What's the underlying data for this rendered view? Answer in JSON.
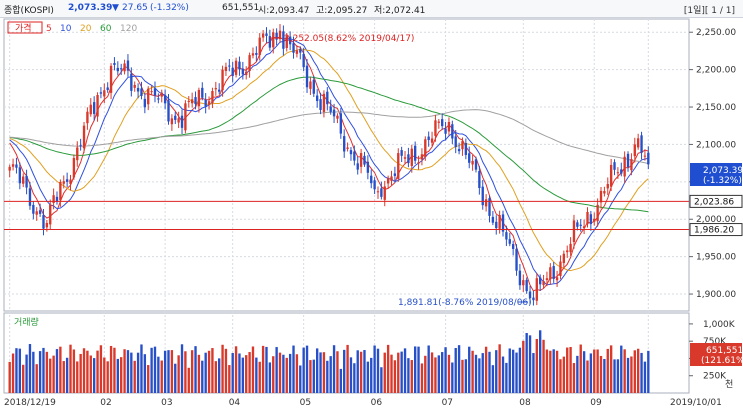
{
  "header": {
    "symbol": "종합(KOSPI)",
    "price": "2,073.39",
    "change_arrow": "▼",
    "change": "27.65",
    "change_pct": "(-1.32%)",
    "volume": "651,551",
    "open": "시:2,093.47",
    "high": "고:2,095.27",
    "low": "저:2,072.41",
    "pager": "[1일][ 1 / 1]"
  },
  "legend": {
    "price_label": "가격",
    "ma": [
      {
        "label": "5",
        "color": "#e03030"
      },
      {
        "label": "10",
        "color": "#3050e0"
      },
      {
        "label": "20",
        "color": "#e0a020"
      },
      {
        "label": "60",
        "color": "#2a9a3a"
      },
      {
        "label": "120",
        "color": "#a0a0a0"
      }
    ],
    "volume_label": "거래량"
  },
  "annotations": {
    "high": "2,252.05(8.62% 2019/04/17)",
    "low": "1,891.81(-8.76% 2019/08/06)"
  },
  "price_axis": {
    "ticks": [
      "2,250.00",
      "2,200.00",
      "2,150.00",
      "2,100.00",
      "2,050.00",
      "2,000.00",
      "1,950.00",
      "1,900.00"
    ],
    "last_box": [
      "2,073.39",
      "(-1.32%)"
    ],
    "hline1": "2,023.86",
    "hline2": "1,986.20"
  },
  "volume_axis": {
    "ticks": [
      "1,000K",
      "750K",
      "500K",
      "250K"
    ],
    "last_box": [
      "651,551",
      "(121.61%)"
    ],
    "unit": "천"
  },
  "x_axis": {
    "labels": [
      "2018/12/19",
      "02",
      "03",
      "04",
      "05",
      "06",
      "07",
      "08",
      "09",
      "2019/10/01"
    ]
  },
  "colors": {
    "up": "#d8392b",
    "down": "#2750c8",
    "hline": "#d22",
    "grid": "#d7dbe2"
  },
  "chart_data": {
    "type": "candlestick",
    "title": "종합(KOSPI)",
    "x_range": [
      "2018/12/19",
      "2019/10/01"
    ],
    "ylim": [
      1880,
      2265
    ],
    "key_points": [
      {
        "x": "2018/12/19",
        "close": 2070
      },
      {
        "x": "2019/01/04",
        "close": 1995
      },
      {
        "x": "2019/02/01",
        "close": 2205
      },
      {
        "x": "2019/03/01",
        "close": 2135
      },
      {
        "x": "2019/04/17",
        "close": 2252.05
      },
      {
        "x": "2019/05/31",
        "close": 2040
      },
      {
        "x": "2019/07/02",
        "close": 2130
      },
      {
        "x": "2019/08/06",
        "close": 1891.81
      },
      {
        "x": "2019/09/20",
        "close": 2100
      },
      {
        "x": "2019/09/27",
        "close": 2073.39
      }
    ],
    "horizontal_lines": [
      2023.86,
      1986.2
    ]
  }
}
